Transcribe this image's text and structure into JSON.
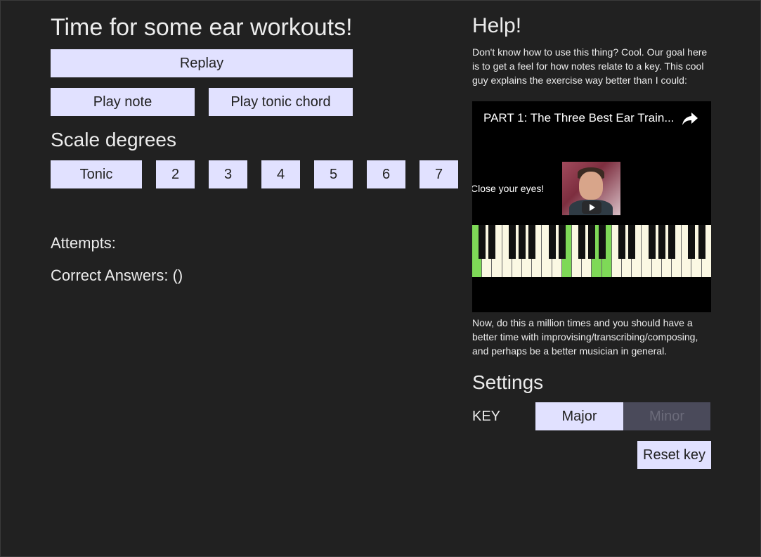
{
  "main": {
    "title": "Time for some ear workouts!",
    "replay_label": "Replay",
    "play_note_label": "Play note",
    "play_chord_label": "Play tonic chord",
    "scale_title": "Scale degrees",
    "degrees": [
      "Tonic",
      "2",
      "3",
      "4",
      "5",
      "6",
      "7"
    ],
    "attempts_label": "Attempts:",
    "correct_label": "Correct Answers: ()"
  },
  "help": {
    "title": "Help!",
    "intro": "Don't know how to use this thing? Cool. Our goal here is to get a feel for how notes relate to a key. This cool guy explains the exercise way better than I could:",
    "video": {
      "title": "PART 1: The Three Best Ear Train...",
      "caption": "Close your eyes!",
      "share_icon": "share-icon",
      "play_icon": "play-icon"
    },
    "outro": "Now, do this a million times and you should have a better time with improvising/transcribing/composing, and perhaps be a better musician in general."
  },
  "settings": {
    "title": "Settings",
    "key_label": "KEY",
    "major_label": "Major",
    "minor_label": "Minor",
    "reset_label": "Reset key",
    "selected": "Major"
  },
  "colors": {
    "background": "#212121",
    "button": "#e1e1ff",
    "toggle_inactive": "#4a4a5a",
    "piano_highlight": "#7ed957"
  }
}
